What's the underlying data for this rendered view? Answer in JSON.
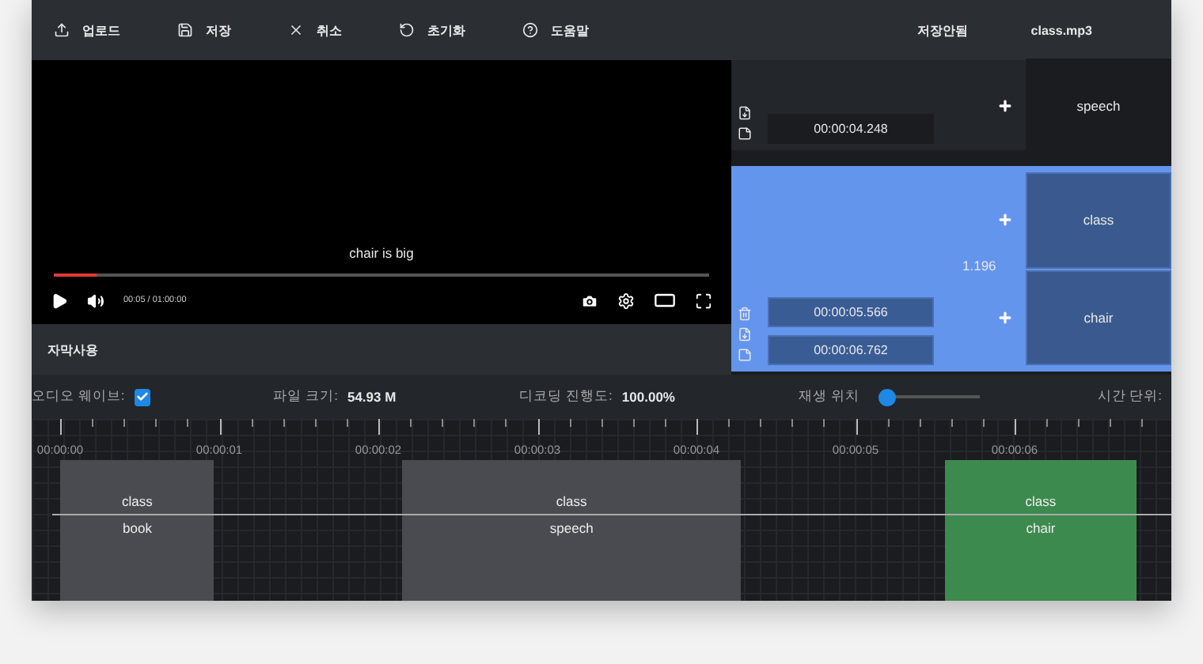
{
  "toolbar": {
    "buttons": [
      {
        "kind": "upload",
        "label": "업로드"
      },
      {
        "kind": "save",
        "label": "저장"
      },
      {
        "kind": "cancel",
        "label": "취소"
      },
      {
        "kind": "reset",
        "label": "초기화"
      },
      {
        "kind": "help",
        "label": "도움말"
      }
    ],
    "save_status": "저장안됨",
    "file_name": "class.mp3"
  },
  "player": {
    "subtitle": "chair is big",
    "level": 0.065,
    "time": "00:05 / 01:00:00"
  },
  "subtitle_toggle": {
    "label": "자막사용"
  },
  "subtitle_rows": [
    {
      "selected": false,
      "times": [
        "00:00:04.248"
      ],
      "texts": [
        "speech"
      ]
    },
    {
      "selected": true,
      "times": [
        "00:00:05.566",
        "00:00:06.762"
      ],
      "duration": "1.196",
      "texts": [
        "class",
        "chair"
      ]
    }
  ],
  "settings": {
    "audio_wave": {
      "label": "오디오 웨이브:",
      "checked": true
    },
    "file_size": {
      "label": "파일 크기:",
      "value": "54.93 M"
    },
    "decoding": {
      "label": "디코딩 진행도:",
      "value": "100.00%"
    },
    "position": {
      "label": "재생 위치",
      "level": 0
    },
    "time_unit": {
      "label": "시간 단위:"
    }
  },
  "timeline": {
    "ticks": [
      "00:00:00",
      "00:00:01",
      "00:00:02",
      "00:00:03",
      "00:00:04",
      "00:00:05",
      "00:00:06"
    ],
    "segments": [
      {
        "selected": false,
        "texts": [
          "class",
          "book"
        ]
      },
      {
        "selected": false,
        "texts": [
          "class",
          "speech"
        ]
      },
      {
        "selected": true,
        "texts": [
          "class",
          "chair"
        ]
      }
    ]
  }
}
